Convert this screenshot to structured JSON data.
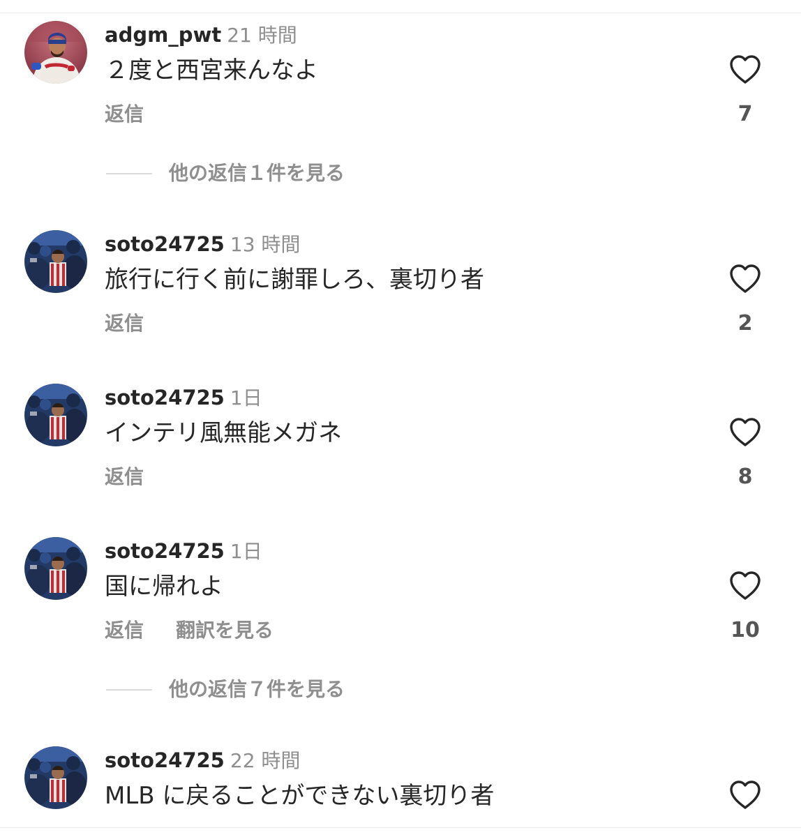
{
  "comments": [
    {
      "username": "adgm_pwt",
      "time": "21 時間",
      "text": "２度と西宮来んなよ",
      "actions": [
        "返信"
      ],
      "likes": "7",
      "view_replies": "他の返信１件を見る",
      "avatar": "player-photo"
    },
    {
      "username": "soto24725",
      "time": "13 時間",
      "text": "旅行に行く前に謝罪しろ、裏切り者",
      "actions": [
        "返信"
      ],
      "likes": "2",
      "avatar": "crowd-photo"
    },
    {
      "username": "soto24725",
      "time": "1日",
      "text": "インテリ風無能メガネ",
      "actions": [
        "返信"
      ],
      "likes": "8",
      "avatar": "crowd-photo"
    },
    {
      "username": "soto24725",
      "time": "1日",
      "text": "国に帰れよ",
      "actions": [
        "返信",
        "翻訳を見る"
      ],
      "likes": "10",
      "view_replies": "他の返信７件を見る",
      "avatar": "crowd-photo"
    },
    {
      "username": "soto24725",
      "time": "22 時間",
      "text": "MLB に戻ることができない裏切り者",
      "actions": [],
      "likes": "",
      "avatar": "crowd-photo"
    }
  ],
  "colors": {
    "text": "#262626",
    "secondary": "#8e8e8e",
    "heart": "#262626",
    "divider": "#dbdbdb"
  }
}
